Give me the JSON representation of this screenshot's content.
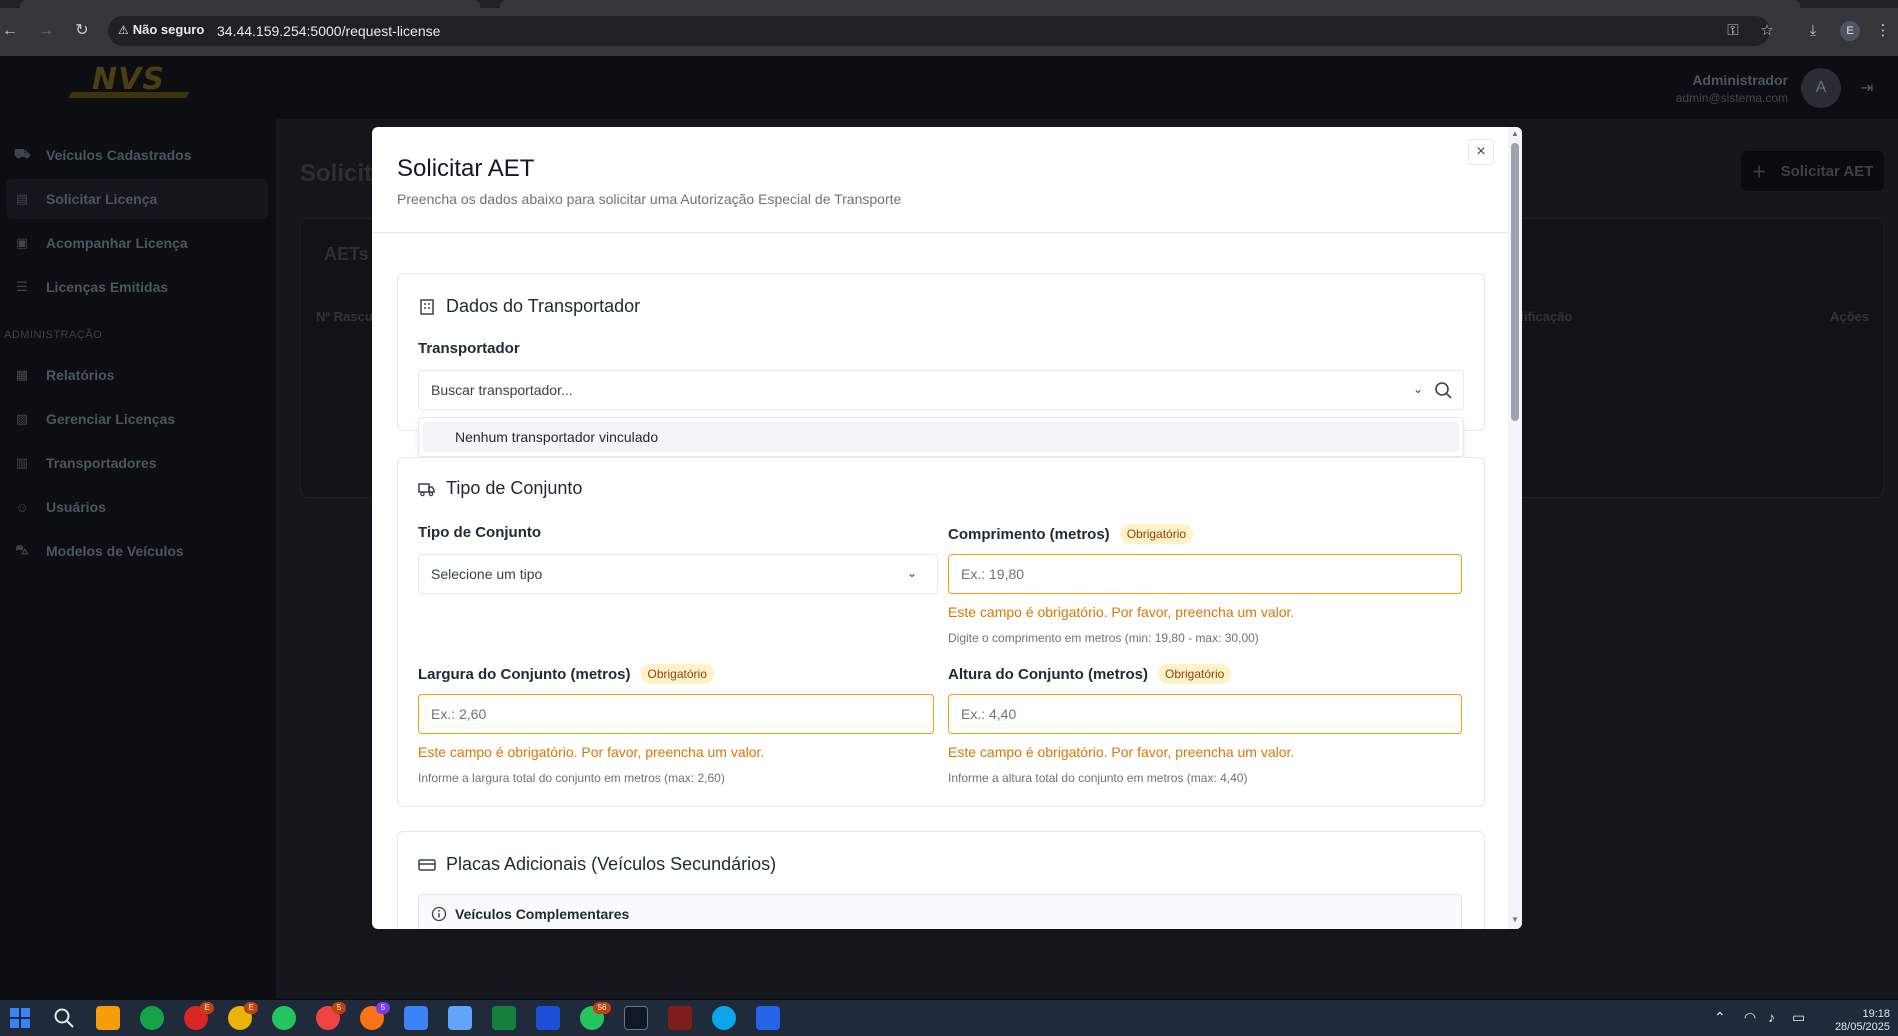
{
  "browser": {
    "security_label": "Não seguro",
    "url": "34.44.159.254:5000/request-license",
    "profile_initial": "E"
  },
  "app": {
    "logo_text": "NVS",
    "user_name": "Administrador",
    "user_email": "admin@sistema.com",
    "avatar_initial": "A"
  },
  "sidebar": {
    "items": [
      {
        "label": "Veículos Cadastrados",
        "icon": "truck-icon"
      },
      {
        "label": "Solicitar Licença",
        "icon": "file-icon"
      },
      {
        "label": "Acompanhar Licença",
        "icon": "clipboard-icon"
      },
      {
        "label": "Licenças Emitidas",
        "icon": "list-check-icon"
      }
    ],
    "admin_section": "ADMINISTRAÇÃO",
    "admin_items": [
      {
        "label": "Relatórios",
        "icon": "grid-icon"
      },
      {
        "label": "Gerenciar Licenças",
        "icon": "file-settings-icon"
      },
      {
        "label": "Transportadores",
        "icon": "building-icon"
      },
      {
        "label": "Usuários",
        "icon": "user-icon"
      },
      {
        "label": "Modelos de Veículos",
        "icon": "car-icon"
      }
    ]
  },
  "page": {
    "title": "Solicit",
    "new_button": "Solicitar AET",
    "card_title": "AETs R",
    "table_headers": [
      "Nº Rascu",
      "dificação",
      "Ações"
    ]
  },
  "modal": {
    "title": "Solicitar AET",
    "subtitle": "Preencha os dados abaixo para solicitar uma Autorização Especial de Transporte",
    "close_symbol": "×",
    "section_transportador": {
      "title": "Dados do Transportador",
      "label": "Transportador",
      "placeholder": "Buscar transportador...",
      "dropdown_option": "Nenhum transportador vinculado"
    },
    "section_conjunto": {
      "title": "Tipo de Conjunto",
      "tipo_label": "Tipo de Conjunto",
      "tipo_value": "Selecione um tipo",
      "required_badge": "Obrigatório",
      "comprimento_label": "Comprimento (metros)",
      "comprimento_placeholder": "Ex.: 19,80",
      "comprimento_hint": "Digite o comprimento em metros (min: 19,80 - max: 30,00)",
      "largura_label": "Largura do Conjunto (metros)",
      "largura_placeholder": "Ex.: 2,60",
      "largura_hint": "Informe a largura total do conjunto em metros (max: 2,60)",
      "altura_label": "Altura do Conjunto (metros)",
      "altura_placeholder": "Ex.: 4,40",
      "altura_hint": "Informe a altura total do conjunto em metros (max: 4,40)",
      "error_message": "Este campo é obrigatório. Por favor, preencha um valor."
    },
    "section_placas": {
      "title": "Placas Adicionais (Veículos Secundários)",
      "info_label": "Veículos Complementares"
    }
  },
  "taskbar": {
    "badges": {
      "chrome2": "E",
      "chrome3": "E",
      "chrome4": "5",
      "chrome5": "5",
      "whatsapp": "56"
    },
    "time": "19:18",
    "date": "28/05/2025"
  },
  "colors": {
    "accent_warning": "#f59e0b",
    "error_text": "#d97706",
    "badge_bg": "#fef3c7"
  }
}
